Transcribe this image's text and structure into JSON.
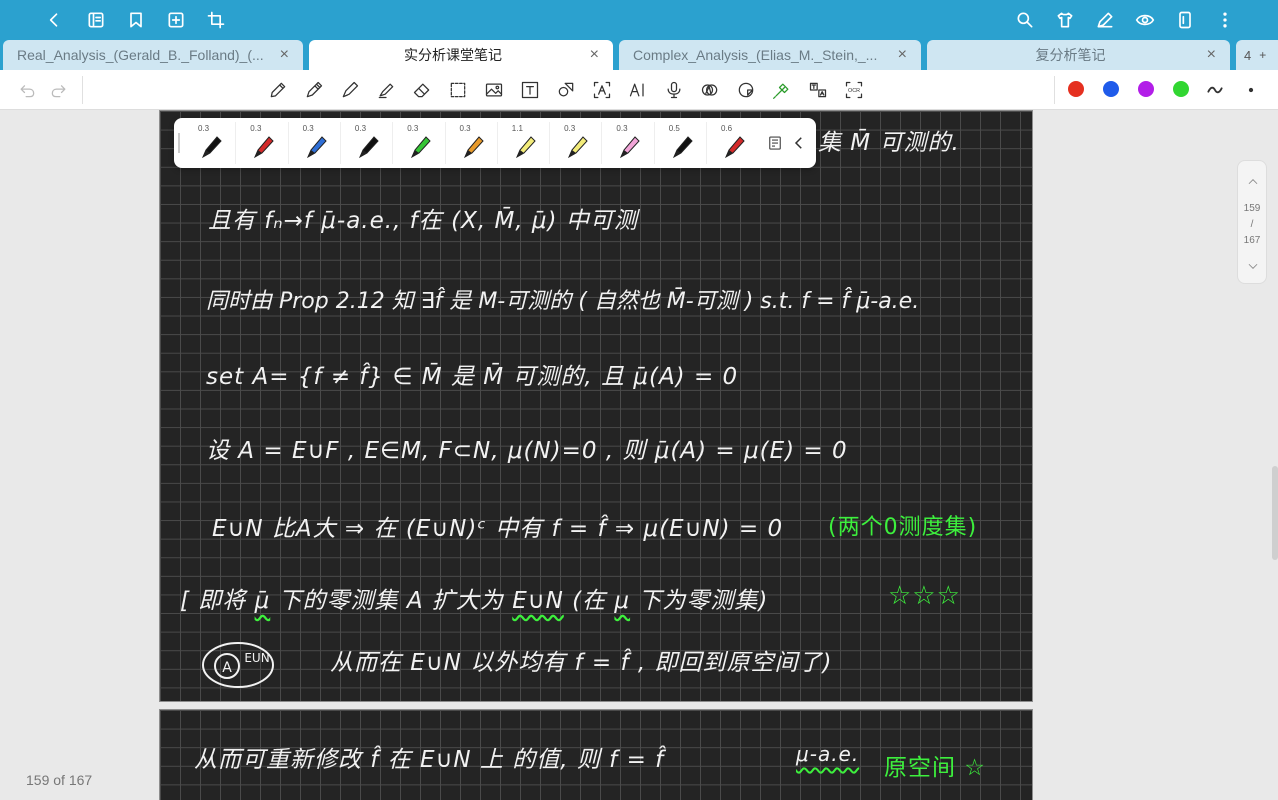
{
  "tabs": [
    {
      "label": "Real_Analysis_(Gerald_B._Folland)_(...",
      "close": "×",
      "active": false
    },
    {
      "label": "实分析课堂笔记",
      "close": "×",
      "active": true
    },
    {
      "label": "Complex_Analysis_(Elias_M._Stein,_...",
      "close": "×",
      "active": false
    },
    {
      "label": "复分析笔记",
      "close": "×",
      "active": false
    }
  ],
  "tab_count": "4",
  "colors": {
    "accent": "#2ba1cf",
    "red": "#e53020",
    "blue": "#1f5bea",
    "purple": "#b21ee8",
    "green": "#31d631"
  },
  "pens": [
    {
      "size": "0.3",
      "color": "#111111"
    },
    {
      "size": "0.3",
      "color": "#d42a2a"
    },
    {
      "size": "0.3",
      "color": "#2f6fd6"
    },
    {
      "size": "0.3",
      "color": "#111111"
    },
    {
      "size": "0.3",
      "color": "#35c535"
    },
    {
      "size": "0.3",
      "color": "#e89a2a"
    },
    {
      "size": "1.1",
      "color": "#f3ec7a"
    },
    {
      "size": "0.3",
      "color": "#f3ec7a"
    },
    {
      "size": "0.3",
      "color": "#f2a5d8"
    },
    {
      "size": "0.5",
      "color": "#111111"
    },
    {
      "size": "0.6",
      "color": "#d42a2a"
    }
  ],
  "notes": {
    "line0": "集 M̄ 可测的.",
    "line1": "且有  fₙ→f   μ̄-a.e.,   f在 (X, M̄, μ̄) 中可测",
    "line2": "同时由 Prop 2.12 知  ∃f̂ 是 M-可测的 ( 自然也 M̄-可测 )    s.t.  f = f̂  μ̄-a.e.",
    "line3": "set  A= {f ≠ f̂} ∈ M̄   是 M̄ 可测的,   且  μ̄(A) = 0",
    "line4": "设 A = E∪F ,  E∈M,  F⊂N,   μ(N)=0 ,  则 μ̄(A) = μ(E) = 0",
    "line5": "E∪N 比A大 ⇒ 在 (E∪N)ᶜ 中有  f = f̂   ⇒  μ(E∪N) = 0",
    "line5_green": "(两个0测度集)",
    "line6a": "[ 即将 ",
    "line6b": "μ̄",
    "line6c": " 下的零测集 A 扩大为 ",
    "line6d": "E∪N",
    "line6e": " (在 ",
    "line6f": "μ",
    "line6g": " 下为零测集)",
    "line6_stars": "☆☆☆",
    "circle_label_a": "A",
    "circle_label_b": "EUN",
    "line7": "从而在  E∪N 以外均有  f = f̂ , 即回到原空间了)",
    "p2_line1": "从而可重新修改 f̂ 在  E∪N 上 的值,  则  f = f̂",
    "p2_line1b": "μ-a.e.",
    "p2_green": "原空间 ☆"
  },
  "scroll": {
    "current": "159",
    "sep": "/",
    "total": "167"
  },
  "page_indicator": "159 of 167"
}
